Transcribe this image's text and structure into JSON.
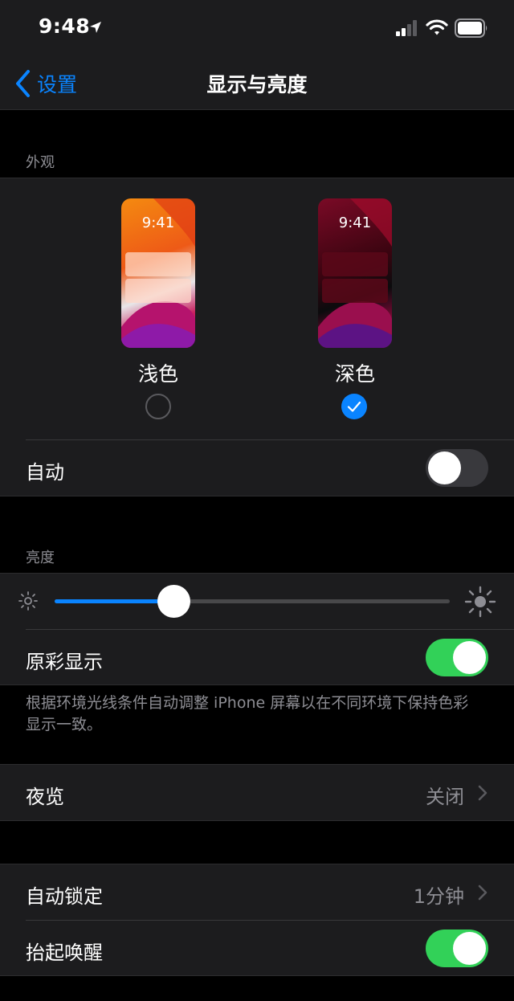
{
  "status_bar": {
    "time": "9:48"
  },
  "nav": {
    "back_label": "设置",
    "title": "显示与亮度"
  },
  "appearance": {
    "header": "外观",
    "light": {
      "label": "浅色",
      "preview_time": "9:41",
      "selected": false
    },
    "dark": {
      "label": "深色",
      "preview_time": "9:41",
      "selected": true
    },
    "auto": {
      "label": "自动",
      "enabled": false
    }
  },
  "brightness": {
    "header": "亮度",
    "level": 0.3,
    "true_tone": {
      "label": "原彩显示",
      "enabled": true
    },
    "footer": "根据环境光线条件自动调整 iPhone 屏幕以在不同环境下保持色彩显示一致。"
  },
  "night_shift": {
    "label": "夜览",
    "value": "关闭"
  },
  "auto_lock": {
    "label": "自动锁定",
    "value": "1分钟"
  },
  "raise_to_wake": {
    "label": "抬起唤醒",
    "enabled": true
  },
  "colors": {
    "accent": "#0a84ff",
    "toggle_on": "#32d158",
    "background": "#000000",
    "cell": "#1c1c1e"
  }
}
